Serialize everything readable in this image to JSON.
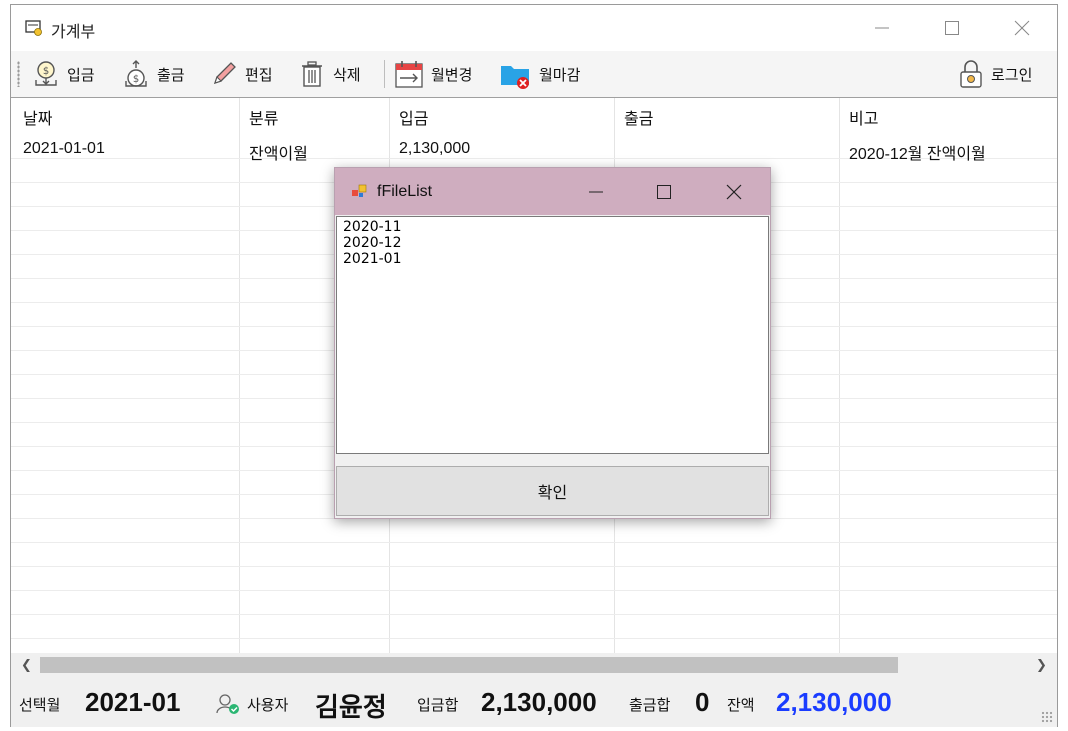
{
  "window": {
    "title": "가계부"
  },
  "toolbar": {
    "deposit_label": "입금",
    "withdraw_label": "출금",
    "edit_label": "편집",
    "delete_label": "삭제",
    "change_month_label": "월변경",
    "close_month_label": "월마감",
    "login_label": "로그인"
  },
  "grid": {
    "columns": [
      "날짜",
      "분류",
      "입금",
      "출금",
      "비고"
    ],
    "rows": [
      {
        "date": "2021-01-01",
        "category": "잔액이월",
        "deposit": "2,130,000",
        "withdraw": "",
        "note": "2020-12월 잔액이월"
      }
    ]
  },
  "status": {
    "month_label": "선택월",
    "month_value": "2021-01",
    "user_label": "사용자",
    "user_value": "김윤정",
    "deposit_sum_label": "입금합",
    "deposit_sum_value": "2,130,000",
    "withdraw_sum_label": "출금합",
    "withdraw_sum_value": "0",
    "balance_label": "잔액",
    "balance_value": "2,130,000"
  },
  "dialog": {
    "title": "fFileList",
    "items": [
      "2020-11",
      "2020-12",
      "2021-01"
    ],
    "ok_label": "확인"
  },
  "colors": {
    "dialog_titlebar": "#cfadbf",
    "balance_blue": "#1a3cff"
  }
}
